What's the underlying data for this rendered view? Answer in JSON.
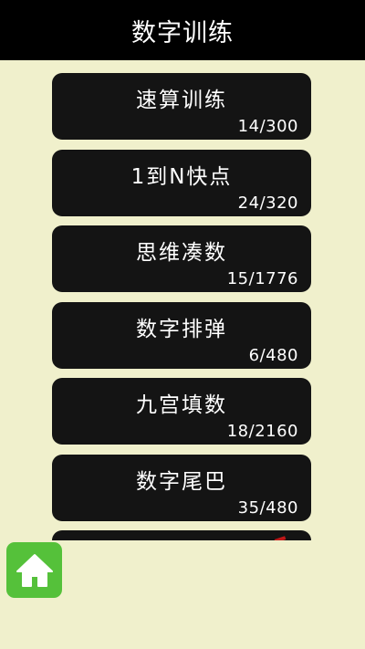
{
  "header": {
    "title": "数字训练"
  },
  "games": [
    {
      "title": "速算训练",
      "progress": "14/300"
    },
    {
      "title": "1到N快点",
      "progress": "24/320"
    },
    {
      "title": "思维凑数",
      "progress": "15/1776"
    },
    {
      "title": "数字排弹",
      "progress": "6/480"
    },
    {
      "title": "九宫填数",
      "progress": "18/2160"
    },
    {
      "title": "数字尾巴",
      "progress": "35/480"
    }
  ],
  "icons": {
    "home": "home-icon"
  },
  "colors": {
    "background": "#f0f0cc",
    "header": "#000000",
    "card": "#141414",
    "home_button": "#55c13a"
  }
}
